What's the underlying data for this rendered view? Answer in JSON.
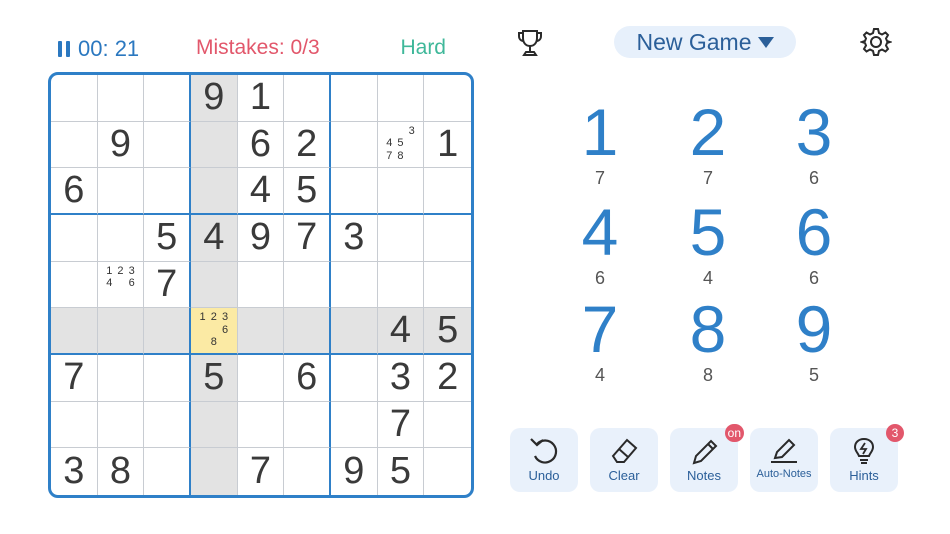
{
  "status": {
    "timer": "00: 21",
    "mistakes": "Mistakes: 0/3",
    "difficulty": "Hard"
  },
  "header": {
    "new_game_label": "New Game"
  },
  "board": {
    "rows": [
      [
        "",
        "",
        "",
        "9",
        "1",
        "",
        "",
        "",
        ""
      ],
      [
        "",
        "9",
        "",
        "",
        "6",
        "2",
        "",
        "",
        "1"
      ],
      [
        "6",
        "",
        "",
        "",
        "4",
        "5",
        "",
        "",
        ""
      ],
      [
        "",
        "",
        "5",
        "4",
        "9",
        "7",
        "3",
        "",
        ""
      ],
      [
        "",
        "",
        "7",
        "",
        "",
        "",
        "",
        "",
        ""
      ],
      [
        "",
        "",
        "",
        "",
        "",
        "",
        "",
        "4",
        "5"
      ],
      [
        "7",
        "",
        "",
        "5",
        "",
        "6",
        "",
        "3",
        "2"
      ],
      [
        "",
        "",
        "",
        "",
        "",
        "",
        "",
        "7",
        ""
      ],
      [
        "3",
        "8",
        "",
        "",
        "7",
        "",
        "9",
        "5",
        ""
      ]
    ],
    "notes": {
      "1-7": [
        "",
        "",
        "3",
        "4",
        "5",
        "",
        "7",
        "8",
        ""
      ],
      "4-1": [
        "1",
        "2",
        "3",
        "4",
        "",
        "6",
        "",
        "",
        ""
      ],
      "5-3": [
        "1",
        "2",
        "3",
        "",
        "",
        "6",
        "",
        "8",
        ""
      ]
    },
    "selected": "5-3",
    "highlight_row": 5,
    "highlight_col": 3,
    "colors": {
      "border": "#2f80c8",
      "highlight": "#e3e3e3",
      "selected": "#fbeaa4"
    }
  },
  "numpad": [
    {
      "digit": "1",
      "remaining": "7"
    },
    {
      "digit": "2",
      "remaining": "7"
    },
    {
      "digit": "3",
      "remaining": "6"
    },
    {
      "digit": "4",
      "remaining": "6"
    },
    {
      "digit": "5",
      "remaining": "4"
    },
    {
      "digit": "6",
      "remaining": "6"
    },
    {
      "digit": "7",
      "remaining": "4"
    },
    {
      "digit": "8",
      "remaining": "8"
    },
    {
      "digit": "9",
      "remaining": "5"
    }
  ],
  "tools": {
    "undo": "Undo",
    "clear": "Clear",
    "notes": "Notes",
    "notes_badge": "on",
    "auto_notes": "Auto-Notes",
    "hints": "Hints",
    "hints_badge": "3"
  },
  "icons": [
    "pause-icon",
    "trophy-icon",
    "caret-down-icon",
    "gear-icon",
    "undo-icon",
    "eraser-icon",
    "pencil-icon",
    "auto-notes-icon",
    "lightbulb-icon"
  ]
}
